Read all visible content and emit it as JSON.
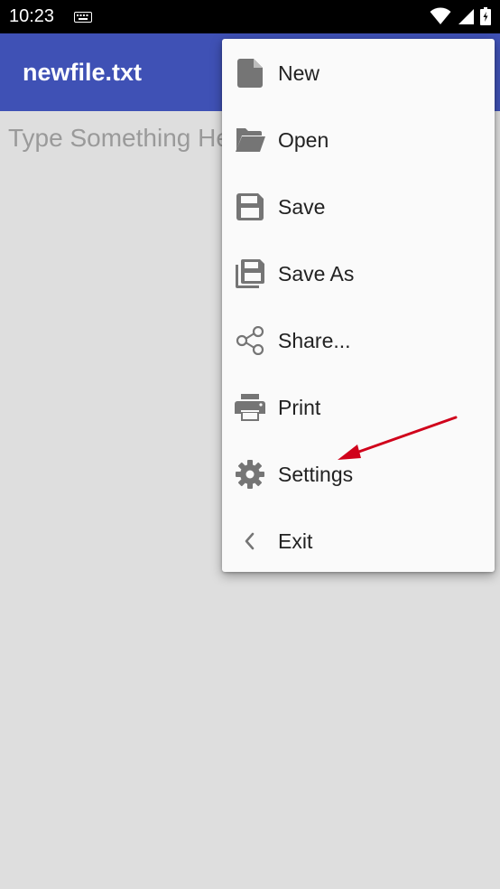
{
  "status_bar": {
    "time": "10:23"
  },
  "app_bar": {
    "title": "newfile.txt"
  },
  "editor": {
    "hint": "Type Something Here"
  },
  "menu": {
    "items": [
      {
        "label": "New",
        "icon": "file-icon"
      },
      {
        "label": "Open",
        "icon": "folder-open-icon"
      },
      {
        "label": "Save",
        "icon": "floppy-icon"
      },
      {
        "label": "Save As",
        "icon": "save-as-icon"
      },
      {
        "label": "Share...",
        "icon": "share-icon"
      },
      {
        "label": "Print",
        "icon": "printer-icon"
      },
      {
        "label": "Settings",
        "icon": "gear-icon"
      },
      {
        "label": "Exit",
        "icon": "chevron-left-icon"
      }
    ]
  },
  "colors": {
    "app_bar": "#3f51b5",
    "menu_bg": "#fafafa",
    "icon": "#757575",
    "annotation_arrow": "#d0021b"
  }
}
